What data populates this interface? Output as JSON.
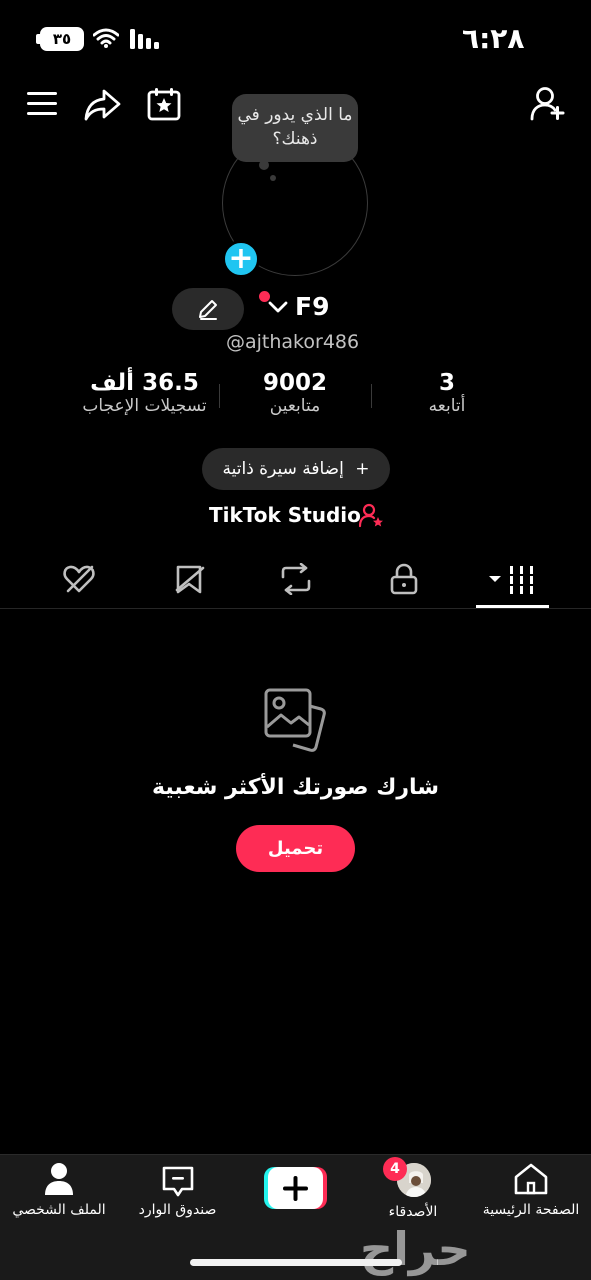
{
  "status_bar": {
    "time": "٦:٢٨",
    "battery": "٣٥"
  },
  "profile": {
    "bubble_text": "ما الذي يدور في ذهنك؟",
    "display_name": "F9",
    "username": "@ajthakor486",
    "bio_button": "إضافة سيرة ذاتية",
    "studio_label": "TikTok Studio",
    "stats": [
      {
        "value": "3",
        "label": "أتابعه"
      },
      {
        "value": "9002",
        "label": "متابعين"
      },
      {
        "value": "36.5 ألف",
        "label": "تسجيلات الإعجاب"
      }
    ]
  },
  "empty_state": {
    "title": "شارك صورتك الأكثر شعبية",
    "button": "تحميل"
  },
  "bottom_nav": {
    "profile": "الملف الشخصي",
    "inbox": "صندوق الوارد",
    "friends": "الأصدقاء",
    "friends_badge": "4",
    "home": "الصفحة الرئيسية"
  },
  "watermark": "حراج",
  "colors": {
    "accent": "#fe2c55",
    "plus_blue": "#20c5f1",
    "background": "#000000",
    "nav_background": "#1a1a1a"
  }
}
